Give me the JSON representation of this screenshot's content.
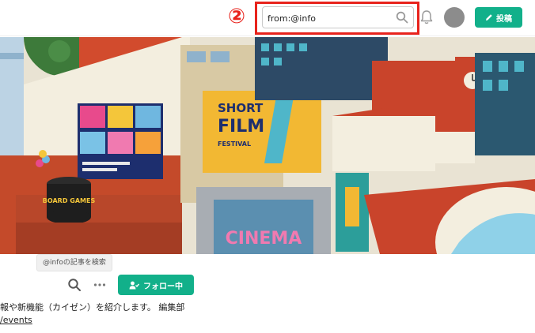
{
  "header": {
    "step_marker": "②",
    "search": {
      "value": "from:@info",
      "placeholder": ""
    },
    "post_button_label": "投稿"
  },
  "cover": {
    "sign_board_game": "BOARD GAMES",
    "sign_film_line1": "SHORT",
    "sign_film_line2": "FILM",
    "sign_film_line3": "FESTIVAL",
    "sign_cinema": "CINEMA"
  },
  "profile": {
    "tooltip": "@infoの記事を検索",
    "follow_label": "フォロー中",
    "bio": "報や新機能（カイゼン）を紹介します。 編集部",
    "bio_link": "/events"
  },
  "colors": {
    "accent": "#12b08a",
    "highlight": "#e8231c"
  },
  "icons": [
    "search-icon",
    "bell-icon",
    "pencil-icon",
    "more-icon",
    "user-check-icon"
  ]
}
